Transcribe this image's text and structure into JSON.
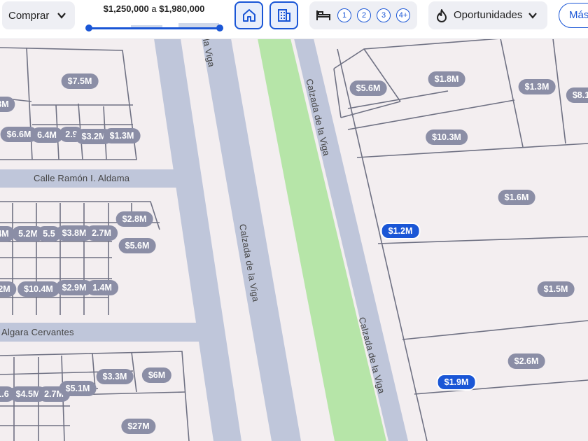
{
  "toolbar": {
    "operation": "Comprar",
    "price_min": "$1,250,000",
    "price_sep": "a",
    "price_max": "$1,980,000",
    "bedrooms_options": [
      "1",
      "2",
      "3",
      "4+"
    ],
    "opportunities": "Oportunidades",
    "more": "Más"
  },
  "colors": {
    "accent": "#1a56d6",
    "price_label": "#8b8ea6",
    "park": "#b6e5a8",
    "road": "#bfc6da",
    "land": "#f3eef0"
  },
  "streets": {
    "aldama": "Calle Ramón I. Aldama",
    "cervantes": "Algara Cervantes",
    "viga_top": "la Viga",
    "viga_center": "Calzada de la Viga",
    "viga_right": "Calzada de la Viga",
    "viga_lower": "Calzada de la Viga"
  },
  "prices": {
    "p1": "$7.5M",
    "p2": "3M",
    "p3": "$6.6M",
    "p4": "6.4M",
    "p5": "2.9",
    "p6": "$3.2M",
    "p7": "$1.3M",
    "p8": "$2.8M",
    "p9": "4M",
    "p10": "5.2M",
    "p11": "5.5",
    "p12": "$3.8M",
    "p13": "2.7M",
    "p14": "$5.6M",
    "p15": "2M",
    "p16": "$10.4M",
    "p17": "$2.9M",
    "p18": "1.4M",
    "p19": "1.6",
    "p20": "$4.5M",
    "p21": "2.7M",
    "p22": "$5.1M",
    "p23": "$3.3M",
    "p24": "$6M",
    "p25": "$27M",
    "p26": "$5.6M",
    "p27": "$1.8M",
    "p28": "$1.3M",
    "p29": "$8.1",
    "p30": "$10.3M",
    "p31": "$1.6M",
    "p32": "$1.2M",
    "p33": "$1.5M",
    "p34": "$2.6M",
    "p35": "$1.9M"
  }
}
